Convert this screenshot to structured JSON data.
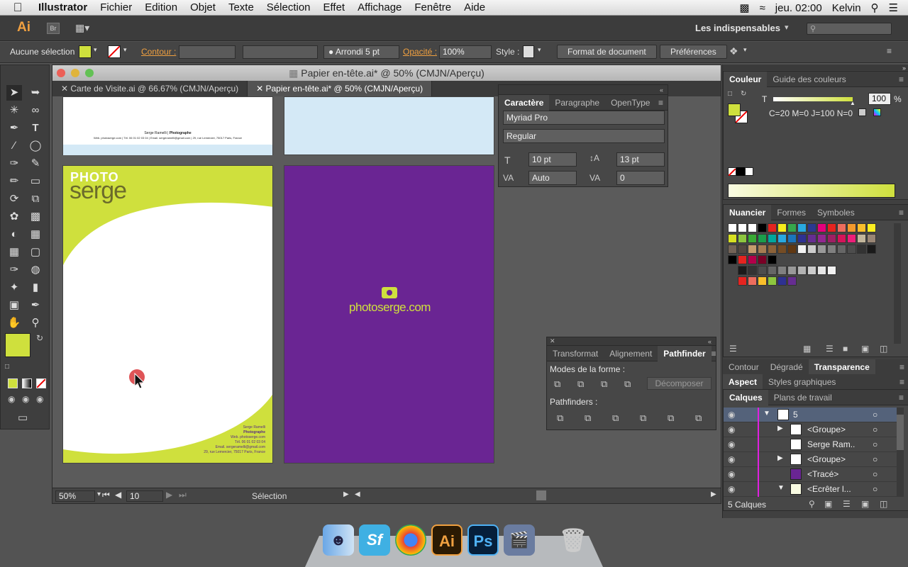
{
  "menubar": {
    "app": "Illustrator",
    "items": [
      "Fichier",
      "Edition",
      "Objet",
      "Texte",
      "Sélection",
      "Effet",
      "Affichage",
      "Fenêtre",
      "Aide"
    ],
    "clock": "jeu. 02:00",
    "user": "Kelvin"
  },
  "appbar": {
    "logo": "Ai",
    "bridge": "Br",
    "workspace": "Les indispensables"
  },
  "control": {
    "selection": "Aucune sélection",
    "stroke_label": "Contour :",
    "brush": "Arrondi 5 pt",
    "opacity_label": "Opacité :",
    "opacity": "100%",
    "style_label": "Style :",
    "doc_format": "Format de document",
    "preferences": "Préférences"
  },
  "document": {
    "window_title": "Papier en-tête.ai* @ 50% (CMJN/Aperçu)",
    "tabs": [
      "Carte de Visite.ai @ 66.67% (CMJN/Aperçu)",
      "Papier en-tête.ai* @ 50% (CMJN/Aperçu)"
    ],
    "zoom": "50%",
    "page": "10",
    "status": "Sélection"
  },
  "artboards": {
    "header_name": "Serge Ramelli",
    "header_role": "Photographe",
    "header_line": "Web. photoserge.com | Tél. 06 01 02 03 04 | Email. sergeramelli@gmail.com | 29, rue Lemercier, 75017 Paris, France",
    "logo_top": "PHOTO",
    "logo_bottom": "serge",
    "footer": [
      "Serge Ramelli",
      "Photographe",
      "Web. photoserge.com",
      "Tél. 06 01 02 03 04",
      "Email. sergeramelli@gmail.com",
      "29, rue Lemercier, 75017 Paris, France"
    ],
    "purple_url": "photoserge.com"
  },
  "character_panel": {
    "tabs": [
      "Caractère",
      "Paragraphe",
      "OpenType"
    ],
    "font": "Myriad Pro",
    "style": "Regular",
    "size": "10 pt",
    "leading": "13 pt",
    "kerning": "Auto",
    "tracking": "0"
  },
  "pathfinder_panel": {
    "tabs": [
      "Transformat",
      "Alignement",
      "Pathfinder"
    ],
    "modes_label": "Modes de la forme :",
    "expand": "Décomposer",
    "pathfinders_label": "Pathfinders :"
  },
  "color_panel": {
    "tabs": [
      "Couleur",
      "Guide des couleurs"
    ],
    "t_label": "T",
    "tint": "100",
    "percent": "%",
    "cmyk": "C=20 M=0 J=100 N=0"
  },
  "swatches_panel": {
    "tabs": [
      "Nuancier",
      "Formes",
      "Symboles"
    ]
  },
  "gradient_tabs": [
    "Contour",
    "Dégradé",
    "Transparence"
  ],
  "aspect_tabs": [
    "Aspect",
    "Styles graphiques"
  ],
  "layers_panel": {
    "tabs": [
      "Calques",
      "Plans de travail"
    ],
    "rows": [
      {
        "name": "5",
        "expand": "▼"
      },
      {
        "name": "<Groupe>",
        "expand": "▶"
      },
      {
        "name": "Serge Ram..",
        "expand": ""
      },
      {
        "name": "<Groupe>",
        "expand": "▶"
      },
      {
        "name": "<Tracé>",
        "expand": ""
      },
      {
        "name": "<Ecrêter l...",
        "expand": "▼"
      }
    ],
    "footer": "5 Calques"
  },
  "colors": {
    "accent_green": "#cfe03d",
    "purple": "#6a2593",
    "light_blue": "#d4e9f6"
  }
}
